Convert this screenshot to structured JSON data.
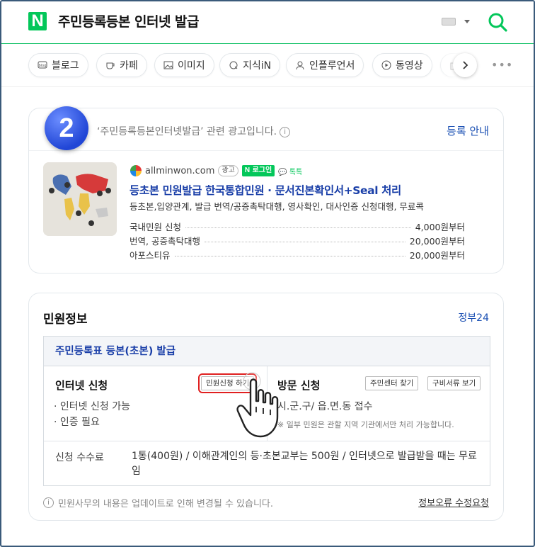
{
  "header": {
    "logo": "N",
    "query": "주민등록등본 인터넷 발급"
  },
  "tabs": [
    {
      "label": "블로그",
      "icon": "blog-icon"
    },
    {
      "label": "카페",
      "icon": "cafe-icon"
    },
    {
      "label": "이미지",
      "icon": "image-icon"
    },
    {
      "label": "지식iN",
      "icon": "q-icon"
    },
    {
      "label": "인플루언서",
      "icon": "person-icon"
    },
    {
      "label": "동영상",
      "icon": "play-icon"
    }
  ],
  "step_badge": "2",
  "ad": {
    "notice": "‘주민등록등본인터넷발급’ 관련 광고입니다.",
    "register_link": "등록 안내",
    "site": "allminwon.com",
    "badge_ad": "광고",
    "badge_login": "로그인",
    "badge_talk": "톡톡",
    "title": "등초본 민원발급 한국통합민원 · 문서진본확인서+Seal 처리",
    "description": "등초본,입양관계, 발급 번역/공증촉탁대행, 영사확인, 대사인증 신청대행, 무료콕",
    "prices": [
      {
        "name": "국내민원 신청",
        "price": "4,000원부터"
      },
      {
        "name": "번역, 공증촉탁대행",
        "price": "20,000원부터"
      },
      {
        "name": "아포스티유",
        "price": "20,000원부터"
      }
    ]
  },
  "info": {
    "title": "민원정보",
    "source": "정부24",
    "service_title": "주민등록표 등본(초본) 발급",
    "internet": {
      "title": "인터넷 신청",
      "button": "민원신청 하기",
      "items": [
        "· 인터넷 신청 가능",
        "· 인증 필요"
      ]
    },
    "visit": {
      "title": "방문 신청",
      "button1": "주민센터 찾기",
      "button2": "구비서류 보기",
      "item": "시.군.구/ 읍.면.동 접수",
      "note": "※ 일부 민원은 관할 지역 기관에서만 처리 가능합니다."
    },
    "fee_label": "신청 수수료",
    "fee_value": "1통(400원) / 이해관계인의 등·초본교부는 500원 / 인터넷으로 발급받을 때는 무료임",
    "footer_note": "민원사무의 내용은 업데이트로 인해 변경될 수 있습니다.",
    "footer_link": "정보오류 수정요청"
  }
}
